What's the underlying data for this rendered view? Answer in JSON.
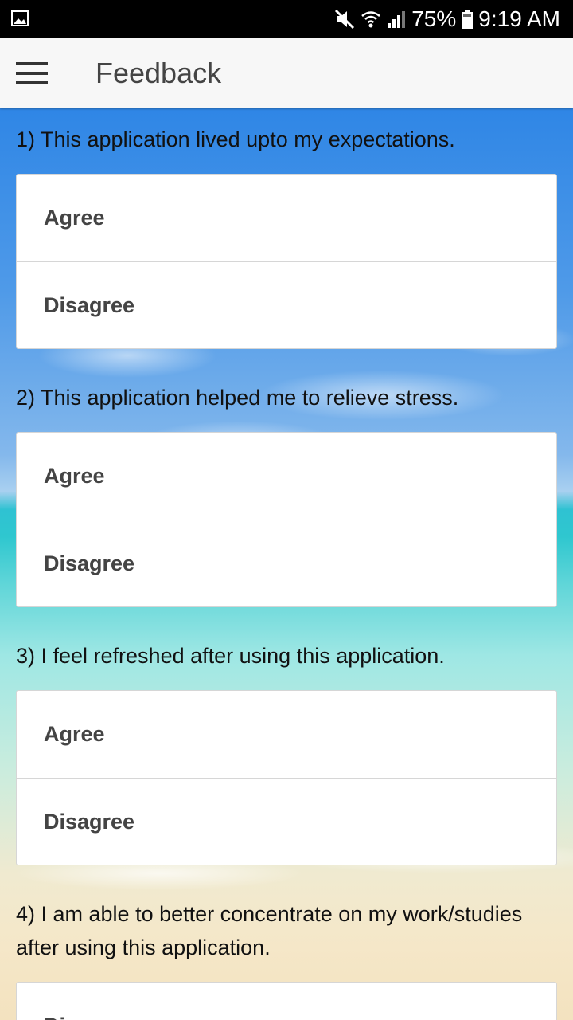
{
  "status_bar": {
    "battery_percent": "75%",
    "time": "9:19 AM",
    "icons": [
      "gallery-icon",
      "mute-icon",
      "wifi-icon",
      "signal-icon",
      "battery-icon"
    ]
  },
  "app_bar": {
    "title": "Feedback",
    "menu_icon": "hamburger-icon"
  },
  "questions": [
    {
      "text": "1) This application lived upto my expectations.",
      "options": [
        "Agree",
        "Disagree"
      ]
    },
    {
      "text": "2) This application helped me to relieve stress.",
      "options": [
        "Agree",
        "Disagree"
      ]
    },
    {
      "text": "3) I feel refreshed after using this application.",
      "options": [
        "Agree",
        "Disagree"
      ]
    },
    {
      "text": "4) I am able to better concentrate on my work/studies after using this application.",
      "options": [
        "Disagree"
      ]
    }
  ],
  "colors": {
    "status_bar_bg": "#000000",
    "app_bar_bg": "#f7f7f7",
    "sky_blue": "#2f86e6",
    "sea_turquoise": "#2fc7cf",
    "sand": "#f3e2bf"
  }
}
